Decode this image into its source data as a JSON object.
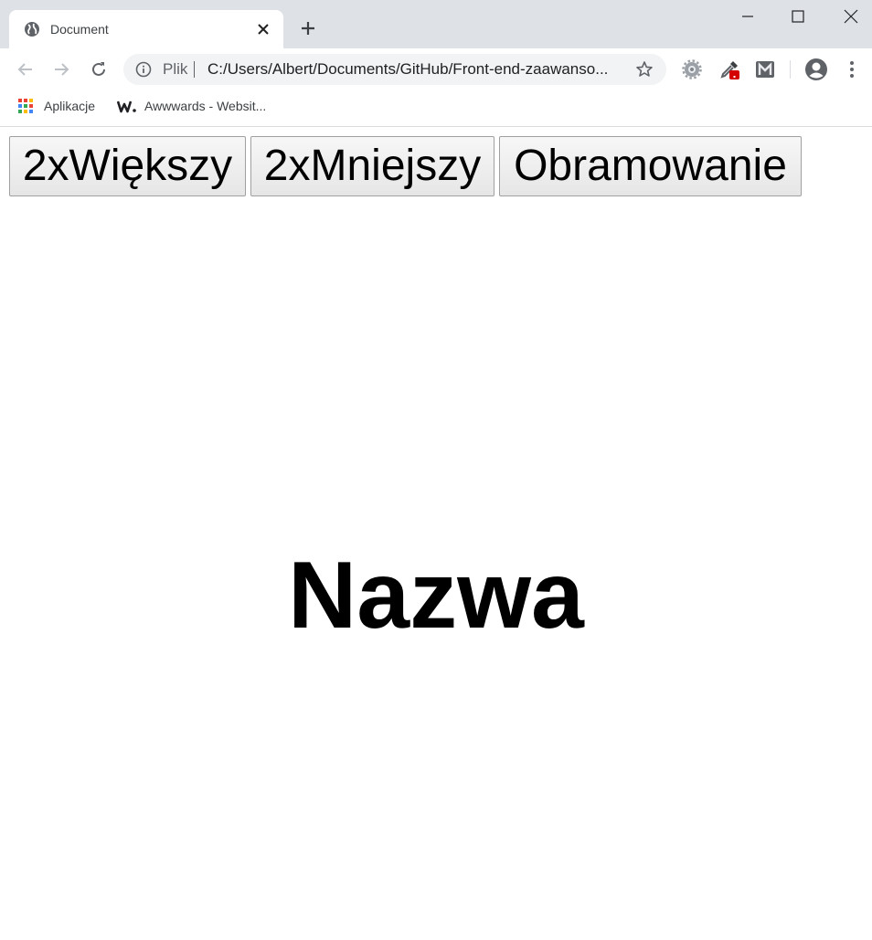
{
  "browser": {
    "tab": {
      "title": "Document",
      "favicon": "globe-icon"
    },
    "window_controls": [
      "minimize-icon",
      "maximize-icon",
      "close-icon"
    ],
    "omnibox": {
      "scheme_label": "Plik",
      "url": "C:/Users/Albert/Documents/GitHub/Front-end-zaawanso..."
    },
    "extensions": [
      "gear-extension-icon",
      "eyedropper-extension-icon",
      "m-extension-icon"
    ],
    "bookmarks": [
      {
        "label": "Aplikacje",
        "icon": "apps-grid-icon"
      },
      {
        "label": "Awwwards - Websit...",
        "icon": "awwwards-w-icon"
      }
    ]
  },
  "page": {
    "buttons": [
      {
        "label": "2xWiększy"
      },
      {
        "label": "2xMniejszy"
      },
      {
        "label": "Obramowanie"
      }
    ],
    "heading": "Nazwa"
  },
  "colors": {
    "tabstrip_bg": "#dee1e6",
    "omnibox_bg": "#f1f3f4",
    "extension_badge": "#d50000",
    "icon_gray": "#5f6368"
  }
}
